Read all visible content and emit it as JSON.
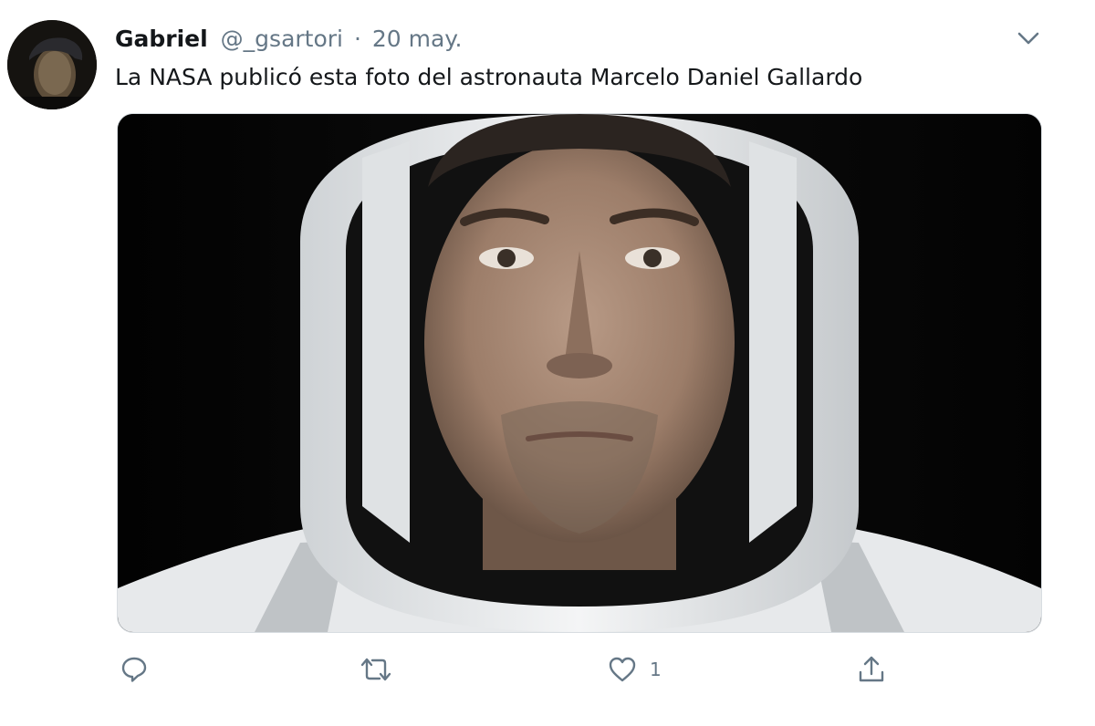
{
  "tweet": {
    "display_name": "Gabriel",
    "handle": "@_gsartori",
    "separator": "·",
    "date": "20 may.",
    "text": "La NASA publicó esta foto del astronauta Marcelo Daniel Gallardo",
    "media": {
      "subject": "astronaut-portrait-photo",
      "background_color": "#050505",
      "suit_color": "#e9ebed"
    },
    "actions": {
      "reply_icon": "comment-icon",
      "retweet_icon": "retweet-icon",
      "like_icon": "heart-icon",
      "like_count": "1",
      "share_icon": "share-icon"
    },
    "colors": {
      "text": "#14171a",
      "secondary": "#657786"
    }
  }
}
